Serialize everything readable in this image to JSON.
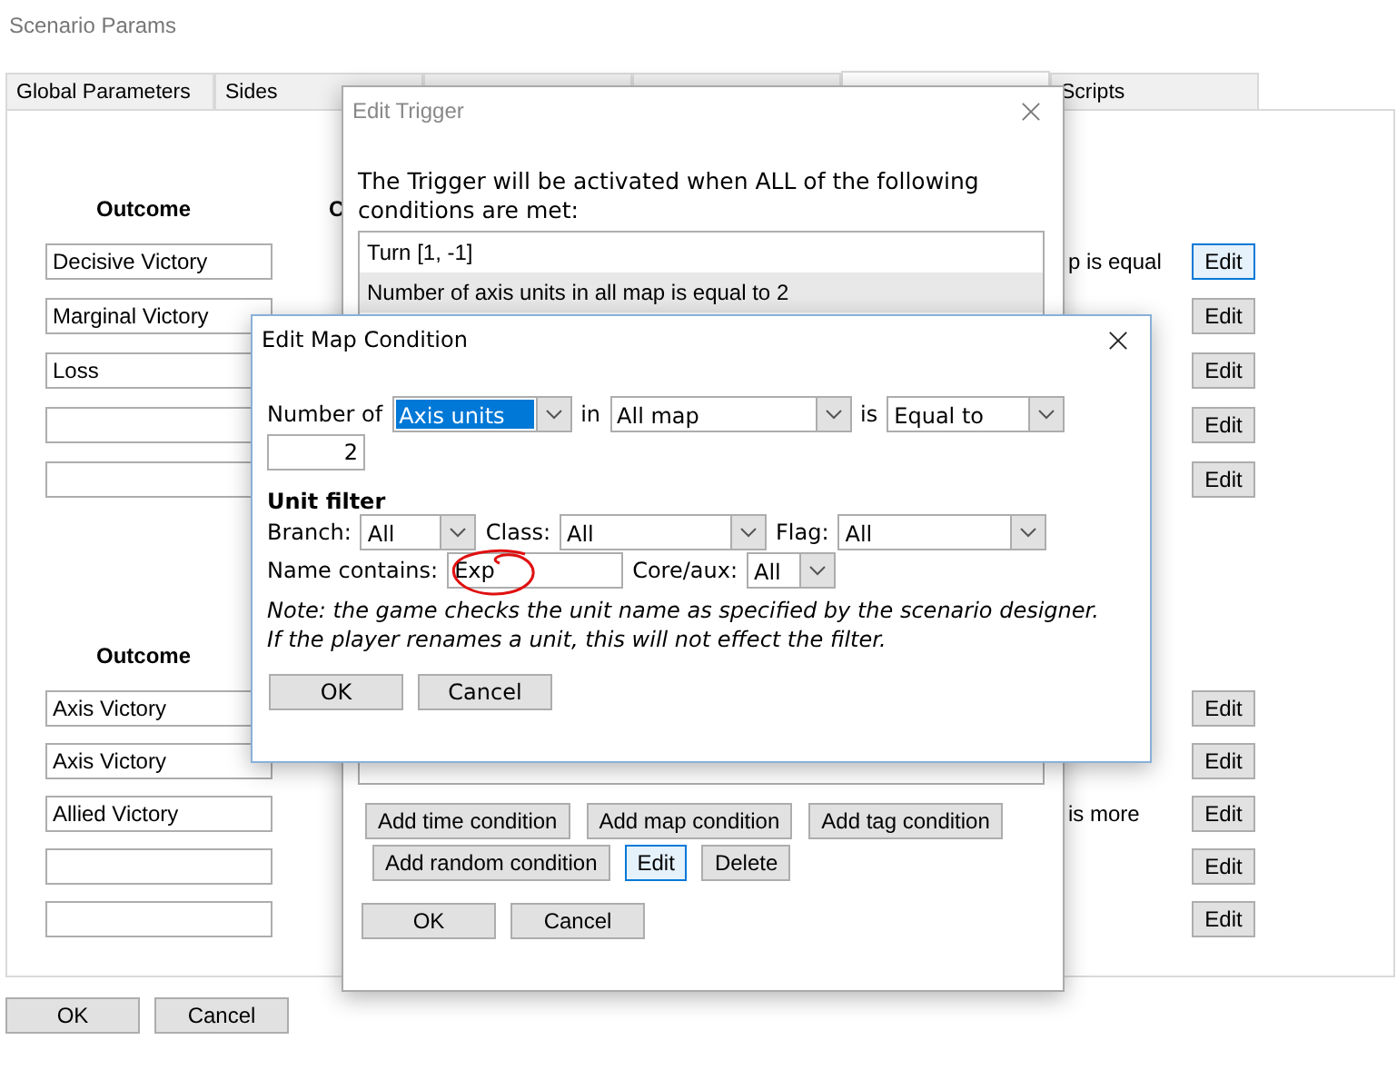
{
  "window": {
    "title": "Scenario Params"
  },
  "tabs": [
    {
      "label": "Global Parameters",
      "selected": false
    },
    {
      "label": "Sides",
      "selected": false
    },
    {
      "selected": false
    },
    {
      "selected": false
    },
    {
      "selected": true
    },
    {
      "label": "Scripts",
      "selected": false
    }
  ],
  "sections": [
    {
      "header": "Outcome",
      "column_2": "C",
      "rows": [
        {
          "outcome": "Decisive Victory",
          "description": "p is equal",
          "button": "Edit",
          "focused": true
        },
        {
          "outcome": "Marginal Victory",
          "button": "Edit",
          "focused": false
        },
        {
          "outcome": "Loss",
          "button": "Edit",
          "focused": false
        },
        {
          "outcome": "",
          "button": "Edit",
          "focused": false
        },
        {
          "outcome": "",
          "button": "Edit",
          "focused": false
        }
      ]
    },
    {
      "header": "Outcome",
      "rows": [
        {
          "outcome": "Axis Victory",
          "button": "Edit",
          "focused": false
        },
        {
          "outcome": "Axis Victory",
          "button": "Edit",
          "focused": false
        },
        {
          "outcome": "Allied Victory",
          "description": "is more",
          "button": "Edit",
          "focused": false
        },
        {
          "outcome": "",
          "button": "Edit",
          "focused": false
        },
        {
          "outcome": "",
          "button": "Edit",
          "focused": false
        }
      ]
    }
  ],
  "buttons": [
    "OK",
    "Cancel"
  ],
  "edit_trigger": {
    "title": "Edit Trigger",
    "message": "The Trigger will be activated when ALL of the following conditions are met:",
    "conditions": [
      {
        "text": "Turn [1, -1]",
        "selected": false
      },
      {
        "text": "Number of axis units in all map is equal to 2",
        "selected": true
      }
    ],
    "button_rows": [
      [
        {
          "label": "Add time condition",
          "focused": false
        },
        {
          "label": "Add map condition",
          "focused": false
        },
        {
          "label": "Add tag condition",
          "focused": false
        }
      ],
      [
        {
          "label": "Add random condition",
          "focused": false
        },
        {
          "label": "Edit",
          "focused": true
        },
        {
          "label": "Delete",
          "focused": false
        }
      ]
    ],
    "buttons": [
      "OK",
      "Cancel"
    ]
  },
  "edit_map_condition": {
    "title": "Edit Map Condition",
    "number_label": "Number of",
    "unit_type": {
      "value": "Axis units",
      "highlighted": true
    },
    "in_label": "in",
    "area": {
      "value": "All map",
      "highlighted": false
    },
    "is_label": "is",
    "comparison": {
      "value": "Equal to",
      "highlighted": false
    },
    "count": "2",
    "unit_filter_title": "Unit filter",
    "branch_label": "Branch:",
    "branch": {
      "value": "All",
      "highlighted": false
    },
    "class_label": "Class:",
    "class": {
      "value": "All",
      "highlighted": false
    },
    "flag_label": "Flag:",
    "flag": {
      "value": "All",
      "highlighted": false
    },
    "name_label": "Name contains:",
    "name": "Exp",
    "core_label": "Core/aux:",
    "core": {
      "value": "All",
      "highlighted": false
    },
    "note": "Note: the game checks the unit name as specified by the scenario designer. If the player renames a unit, this will not effect the filter.",
    "buttons": [
      "OK",
      "Cancel"
    ]
  }
}
